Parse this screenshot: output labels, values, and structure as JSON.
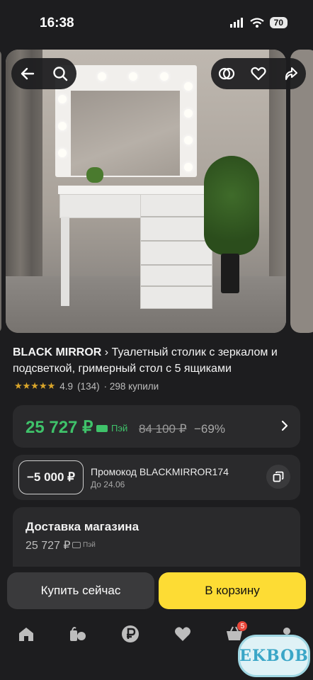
{
  "status_bar": {
    "time": "16:38",
    "battery": "70"
  },
  "product": {
    "brand": "BLACK MIRROR",
    "breadcrumb_sep": "›",
    "name": "Туалетный столик с зеркалом и подсветкой, гримерный стол с 5 ящиками",
    "stars": "★★★★★",
    "rating": "4.9",
    "reviews": "(134)",
    "sold": "· 298 купили"
  },
  "price": {
    "current": "25 727 ₽",
    "pay_label": "Пэй",
    "old": "84 100 ₽",
    "discount": "−69%"
  },
  "promo": {
    "value": "−5 000 ₽",
    "code": "Промокод BLACKMIRROR174",
    "until": "До 24.06"
  },
  "delivery": {
    "title": "Доставка магазина",
    "price": "25 727 ₽",
    "pay_label": "Пэй"
  },
  "actions": {
    "buy_now": "Купить сейчас",
    "add_to_cart": "В корзину"
  },
  "tabbar": {
    "cart_count": "5"
  },
  "watermark": "EKBOB",
  "colors": {
    "price_green": "#3fc26a",
    "cart_yellow": "#fddc34",
    "star_gold": "#d9a52a"
  }
}
